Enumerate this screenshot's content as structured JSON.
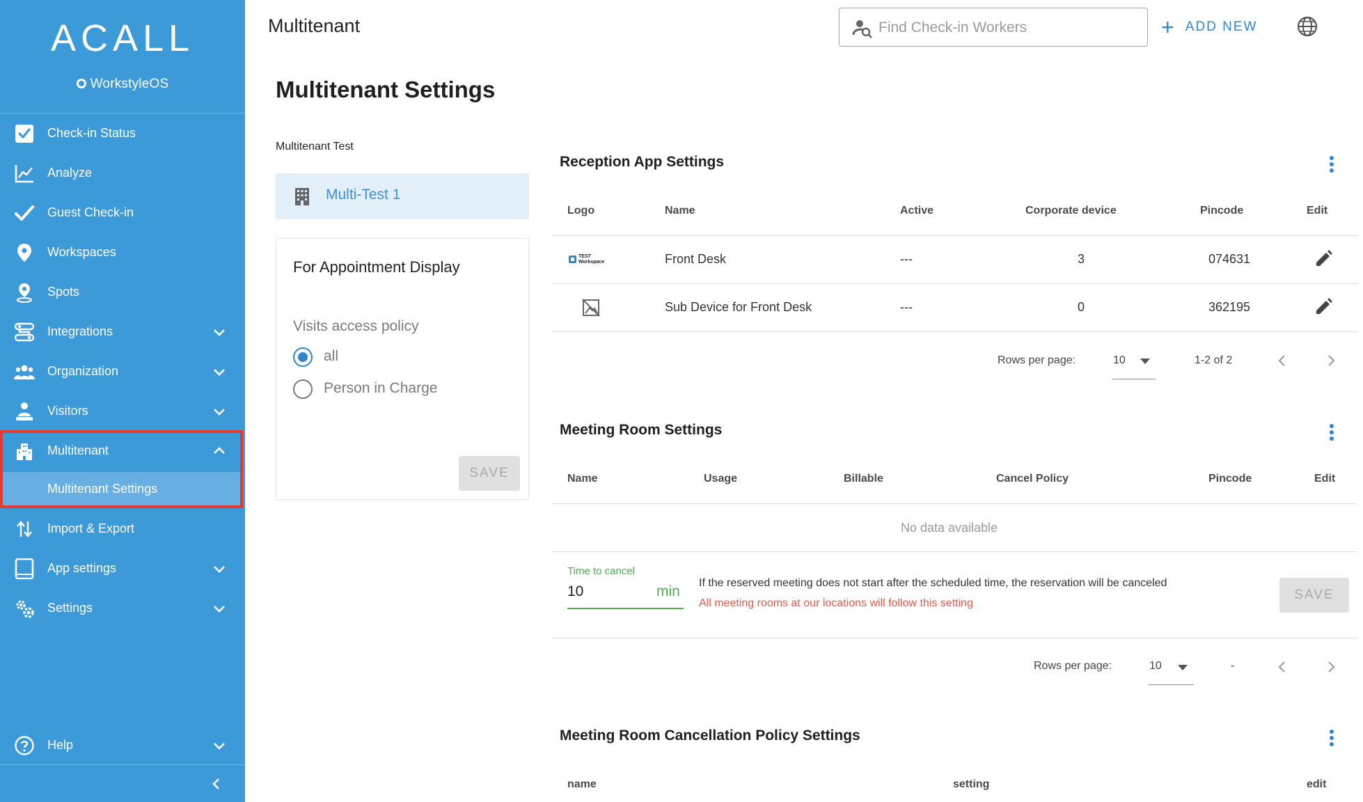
{
  "brand": {
    "logo": "ACALL",
    "sub": "WorkstyleOS"
  },
  "sidebar": {
    "items": [
      {
        "label": "Check-in Status",
        "icon": "checkbox-icon"
      },
      {
        "label": "Analyze",
        "icon": "chart-icon"
      },
      {
        "label": "Guest Check-in",
        "icon": "checkmark-icon"
      },
      {
        "label": "Workspaces",
        "icon": "location-pin-icon"
      },
      {
        "label": "Spots",
        "icon": "person-pin-icon"
      },
      {
        "label": "Integrations",
        "icon": "integrations-icon"
      },
      {
        "label": "Organization",
        "icon": "group-icon"
      },
      {
        "label": "Visitors",
        "icon": "visitor-icon"
      },
      {
        "label": "Multitenant",
        "icon": "building-icon"
      },
      {
        "label": "Import & Export",
        "icon": "import-export-icon"
      },
      {
        "label": "App settings",
        "icon": "tablet-icon"
      },
      {
        "label": "Settings",
        "icon": "gears-icon"
      },
      {
        "label": "Help",
        "icon": "help-icon"
      }
    ],
    "sub_item": "Multitenant Settings",
    "highlight_color": "#e8382e"
  },
  "header": {
    "title": "Multitenant",
    "search_placeholder": "Find Check-in Workers",
    "add_new": "ADD NEW"
  },
  "page_title": "Multitenant Settings",
  "left_panel": {
    "caption": "Multitenant Test",
    "tenant": "Multi-Test 1",
    "card_title": "For Appointment Display",
    "policy_label": "Visits access policy",
    "options": [
      "all",
      "Person in Charge"
    ],
    "selected": "all",
    "save": "SAVE"
  },
  "reception": {
    "title": "Reception App Settings",
    "columns": [
      "Logo",
      "Name",
      "Active",
      "Corporate device",
      "Pincode",
      "Edit"
    ],
    "rows": [
      {
        "logo_text": "TEST Workspace",
        "name": "Front Desk",
        "active": "---",
        "corporate_device": "3",
        "pincode": "074631"
      },
      {
        "logo_text": "",
        "name": "Sub Device for Front Desk",
        "active": "---",
        "corporate_device": "0",
        "pincode": "362195"
      }
    ],
    "rows_per_page_label": "Rows per page:",
    "rows_per_page": "10",
    "range": "1-2 of 2"
  },
  "meeting_room": {
    "title": "Meeting Room Settings",
    "columns": [
      "Name",
      "Usage",
      "Billable",
      "Cancel Policy",
      "Pincode",
      "Edit"
    ],
    "empty": "No data available",
    "time_to_cancel_label": "Time to cancel",
    "time_to_cancel_value": "10",
    "time_unit": "min",
    "description": "If the reserved meeting does not start after the scheduled time, the reservation will be canceled",
    "warning": "All meeting rooms at our locations will follow this setting",
    "save": "SAVE",
    "rows_per_page_label": "Rows per page:",
    "rows_per_page": "10",
    "range": "-"
  },
  "cancellation": {
    "title": "Meeting Room Cancellation Policy Settings",
    "columns": [
      "name",
      "setting",
      "edit"
    ]
  },
  "colors": {
    "sidebar": "#3d9ad8",
    "accent": "#2e86d0",
    "success": "#4caf50",
    "warning": "#e35a4c"
  }
}
